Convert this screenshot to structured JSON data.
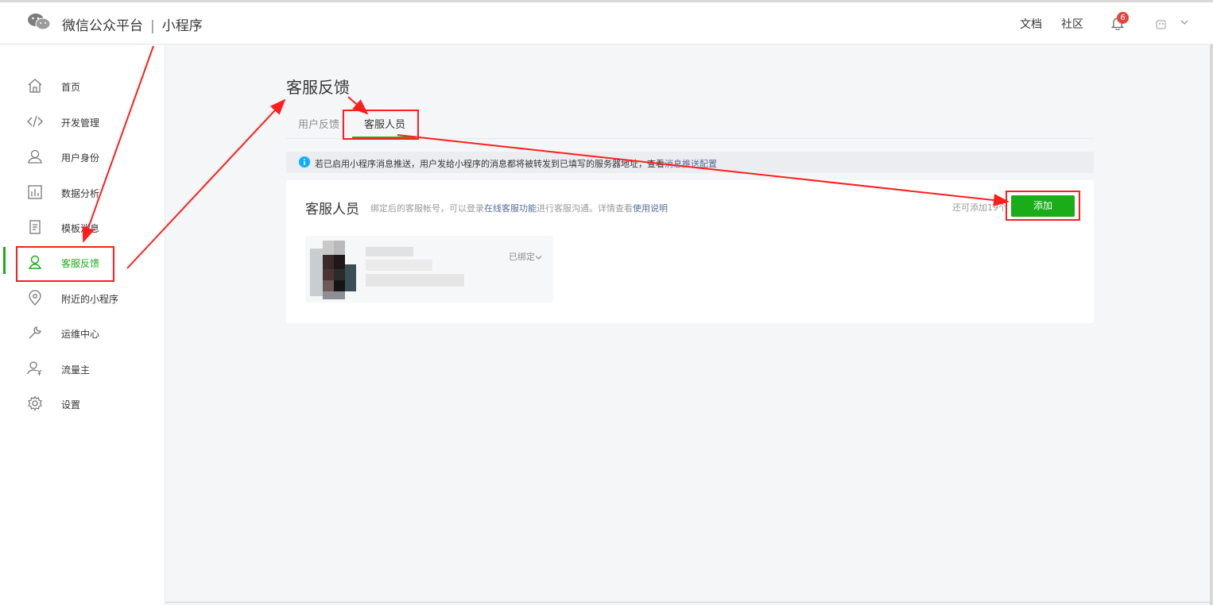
{
  "header": {
    "brand": "微信公众平台",
    "separator": "|",
    "product": "小程序",
    "links": [
      "文档",
      "社区"
    ],
    "notification_count": "6"
  },
  "sidebar": {
    "items": [
      {
        "label": "首页",
        "icon": "home-icon"
      },
      {
        "label": "开发管理",
        "icon": "code-icon"
      },
      {
        "label": "用户身份",
        "icon": "user-icon"
      },
      {
        "label": "数据分析",
        "icon": "chart-icon"
      },
      {
        "label": "模板消息",
        "icon": "document-icon"
      },
      {
        "label": "客服反馈",
        "icon": "service-icon",
        "active": true
      },
      {
        "label": "附近的小程序",
        "icon": "location-icon"
      },
      {
        "label": "运维中心",
        "icon": "wrench-icon"
      },
      {
        "label": "流量主",
        "icon": "user-yen-icon"
      },
      {
        "label": "设置",
        "icon": "gear-icon"
      }
    ]
  },
  "main": {
    "title": "客服反馈",
    "tabs": [
      {
        "label": "用户反馈",
        "active": false
      },
      {
        "label": "客服人员",
        "active": true
      }
    ],
    "notice": {
      "text": "若已启用小程序消息推送，用户发给小程序的消息都将被转发到已填写的服务器地址，查看",
      "link": "消息推送配置"
    },
    "card": {
      "title": "客服人员",
      "desc_prefix": "绑定后的客服帐号，可以登录",
      "desc_link1": "在线客服功能",
      "desc_middle": "进行客服沟通。详情查看",
      "desc_link2": "使用说明",
      "remaining": "还可添加19个",
      "add_button": "添加",
      "staff": [
        {
          "status": "已绑定"
        }
      ]
    }
  },
  "colors": {
    "accent": "#1aad19",
    "link": "#576b95",
    "annotation": "#ff1e1e",
    "badge": "#e64340"
  }
}
